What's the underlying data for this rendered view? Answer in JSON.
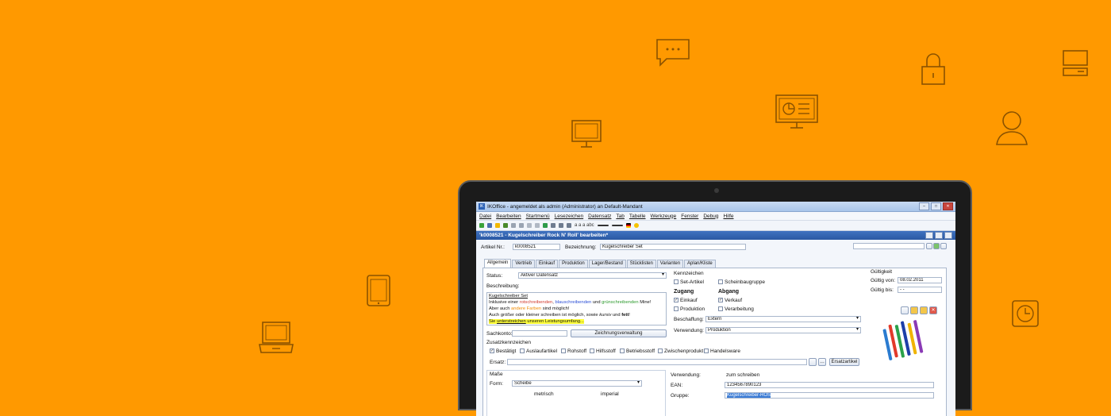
{
  "window": {
    "title": "IKOffice - angemeldet als admin (Administrator) an Default-Mandant",
    "app_icon": "IK"
  },
  "menu": [
    "Datei",
    "Bearbeiten",
    "Startmenü",
    "Lesezeichen",
    "Datensatz",
    "Tab",
    "Tabelle",
    "Werkzeuge",
    "Fenster",
    "Debug",
    "Hilfe"
  ],
  "toolbar": {
    "font_sample": "a a a abc"
  },
  "document": {
    "title": "'k0008521 - Kugelschreiber Rock N' Roll' bearbeiten*"
  },
  "form": {
    "artikel_label": "Artikel Nr.:",
    "artikel_value": "k0008521",
    "bezeichnung_label": "Bezeichnung:",
    "bezeichnung_value": "Kugelschreiber Set",
    "tabs": [
      "Allgemein",
      "Vertrieb",
      "Einkauf",
      "Produktion",
      "Lager/Bestand",
      "Stücklisten",
      "Varianten",
      "Aplan/Kliste"
    ],
    "status_label": "Status:",
    "status_value": "Aktiver Datensatz",
    "beschreibung_label": "Beschreibung:",
    "desc": {
      "line1": "Kugelschreiber Set",
      "l2a": "Inklusive einer ",
      "l2red": "rotschreibenden",
      "l2b": ", ",
      "l2blue": "blauschreibenden",
      "l2c": " und ",
      "l2green": "grünschreibenden",
      "l2d": " Mine!",
      "l3a": "Aber auch ",
      "l3orange": "andere Farben",
      "l3b": " sind möglich!",
      "l4a": "Auch größer oder kleiner schreiben ist möglich, sowie ",
      "l4italic": "kursiv",
      "l4b": " und ",
      "l4bold": "fett",
      "l4c": "!",
      "l5a": "Sie ",
      "l5u": "unterstreichen",
      "l5b": " unseren Leistungsumfang..."
    },
    "sachkonto_label": "Sachkonto:",
    "zeichnung_button": "Zeichnungsverwaltung",
    "kennzeichen_label": "Kennzeichen",
    "set_artikel": "Set-Artikel",
    "scheinbaugruppe": "Scheinbaugruppe",
    "zugang_label": "Zugang",
    "abgang_label": "Abgang",
    "einkauf": "Einkauf",
    "verkauf": "Verkauf",
    "produktion": "Produktion",
    "verarbeitung": "Verarbeitung",
    "beschaffung_label": "Beschaffung:",
    "beschaffung_value": "Extern",
    "verwendung_label": "Verwendung:",
    "verwendung_value": "Produktion",
    "gueltigkeit_label": "Gültigkeit",
    "gueltig_von_label": "Gültig von:",
    "gueltig_von_value": "08.02.2011",
    "gueltig_bis_label": "Gültig bis:",
    "gueltig_bis_value": "- -",
    "zusatz_label": "Zusatzkennzeichen",
    "zusatz_items": [
      "Bestätigt",
      "Auslaufartikel",
      "Rohstoff",
      "Hilfsstoff",
      "Betriebsstoff",
      "Zwischenprodukt",
      "Handelsware"
    ],
    "ersatz_label": "Ersatz:",
    "ersatzartikel_button": "Ersatzartikel",
    "masse_label": "Maße",
    "form_label": "Form:",
    "form_value": "Scheibe",
    "metrisch": "metrisch",
    "imperial": "imperial",
    "verwendung2_label": "Verwendung:",
    "verwendung2_value": "zum schreiben",
    "ean_label": "EAN:",
    "ean_value": "1234567890123",
    "gruppe_label": "Gruppe:",
    "gruppe_value": "Kugelschreiber-ROS"
  },
  "colors": {
    "background": "#ff9900",
    "accent": "#2a58a3"
  }
}
